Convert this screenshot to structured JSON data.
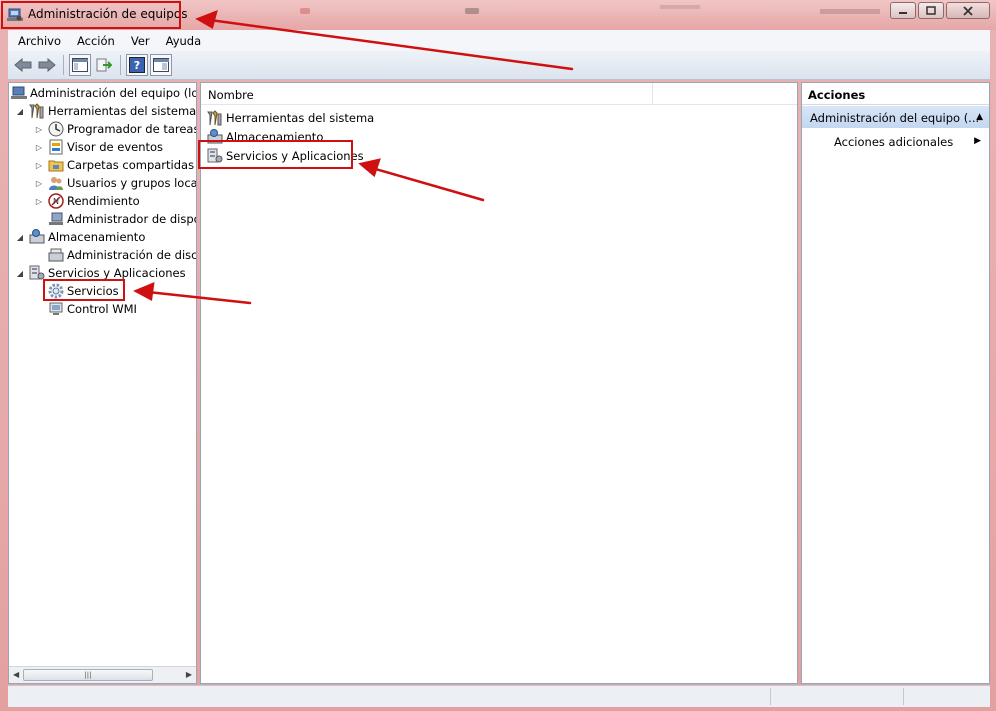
{
  "window": {
    "title": "Administración de equipos"
  },
  "menubar": {
    "items": [
      "Archivo",
      "Acción",
      "Ver",
      "Ayuda"
    ]
  },
  "toolbar": {
    "icons": [
      "back-icon",
      "forward-icon",
      "show-hide-tree-icon",
      "export-list-icon",
      "help-icon",
      "properties-icon"
    ]
  },
  "tree": {
    "root": "Administración del equipo (loc",
    "system_tools": "Herramientas del sistema",
    "task_scheduler": "Programador de tareas",
    "event_viewer": "Visor de eventos",
    "shared_folders": "Carpetas compartidas",
    "users_groups": "Usuarios y grupos locale",
    "performance": "Rendimiento",
    "device_manager": "Administrador de dispo",
    "storage": "Almacenamiento",
    "disk_management": "Administración de disco",
    "services_apps": "Servicios y Aplicaciones",
    "services": "Servicios",
    "wmi_control": "Control WMI"
  },
  "list": {
    "column_name": "Nombre",
    "rows": [
      "Herramientas del sistema",
      "Almacenamiento",
      "Servicios y Aplicaciones"
    ]
  },
  "actions": {
    "header": "Acciones",
    "selected": "Administración del equipo (...",
    "more_actions": "Acciones adicionales"
  },
  "colors": {
    "annotation_red": "#d01010",
    "selection_blue": "#c3d7f0"
  }
}
